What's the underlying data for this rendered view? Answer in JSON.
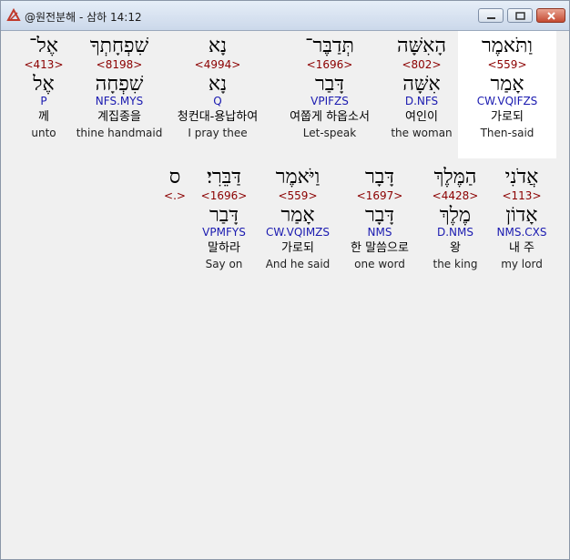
{
  "window": {
    "title": "@원전분해 - 삼하 14:12",
    "icons": {
      "app": "bible-app-icon",
      "minimize": "minimize-icon",
      "maximize": "maximize-icon",
      "close": "close-icon"
    }
  },
  "row1": [
    {
      "heb": "וַתֹּאמֶר",
      "strong": "<559>",
      "root": "אָמַר",
      "parse": "CW.VQIFZS",
      "kor": "가로되",
      "eng": "Then-said"
    },
    {
      "heb": "הָאִשָּׁה",
      "strong": "<802>",
      "root": "אִשָּׁה",
      "parse": "D.NFS",
      "kor": "여인이",
      "eng": "the woman"
    },
    {
      "heb": "תְּדַבֶּר־",
      "strong": "<1696>",
      "root": "דָּבַר",
      "parse": "VPIFZS",
      "kor": "여쭙게 하옵소서",
      "eng": "Let-speak"
    },
    {
      "heb": "נָא",
      "strong": "<4994>",
      "root": "נָא",
      "parse": "Q",
      "kor": "청컨대-용납하여",
      "eng": "I pray thee"
    },
    {
      "heb": "שִׁפְחָתְךָ",
      "strong": "<8198>",
      "root": "שִׁפְחָה",
      "parse": "NFS.MYS",
      "kor": "계집종을",
      "eng": "thine handmaid"
    },
    {
      "heb": "אֶל־",
      "strong": "<413>",
      "root": "אֶל",
      "parse": "P",
      "kor": "께",
      "eng": "unto"
    }
  ],
  "row2": [
    {
      "heb": "אֲדֹנִי",
      "strong": "<113>",
      "root": "אָדוֹן",
      "parse": "NMS.CXS",
      "kor": "내 주",
      "eng": "my lord"
    },
    {
      "heb": "הַמֶּלֶךְ",
      "strong": "<4428>",
      "root": "מֶלֶךְ",
      "parse": "D.NMS",
      "kor": "왕",
      "eng": "the king"
    },
    {
      "heb": "דָּבָר",
      "strong": "<1697>",
      "root": "דָּבָר",
      "parse": "NMS",
      "kor": "한 말씀으로",
      "eng": "one word"
    },
    {
      "heb": "וַיֹּאמֶר",
      "strong": "<559>",
      "root": "אָמַר",
      "parse": "CW.VQIMZS",
      "kor": "가로되",
      "eng": "And he said"
    },
    {
      "heb": "דַּבֵּרִי׃",
      "strong": "<1696>",
      "root": "דָּבַר",
      "parse": "VPMFYS",
      "kor": "말하라",
      "eng": "Say on"
    },
    {
      "heb": "ס",
      "strong": "<.>",
      "root": "",
      "parse": "",
      "kor": "",
      "eng": ""
    }
  ]
}
